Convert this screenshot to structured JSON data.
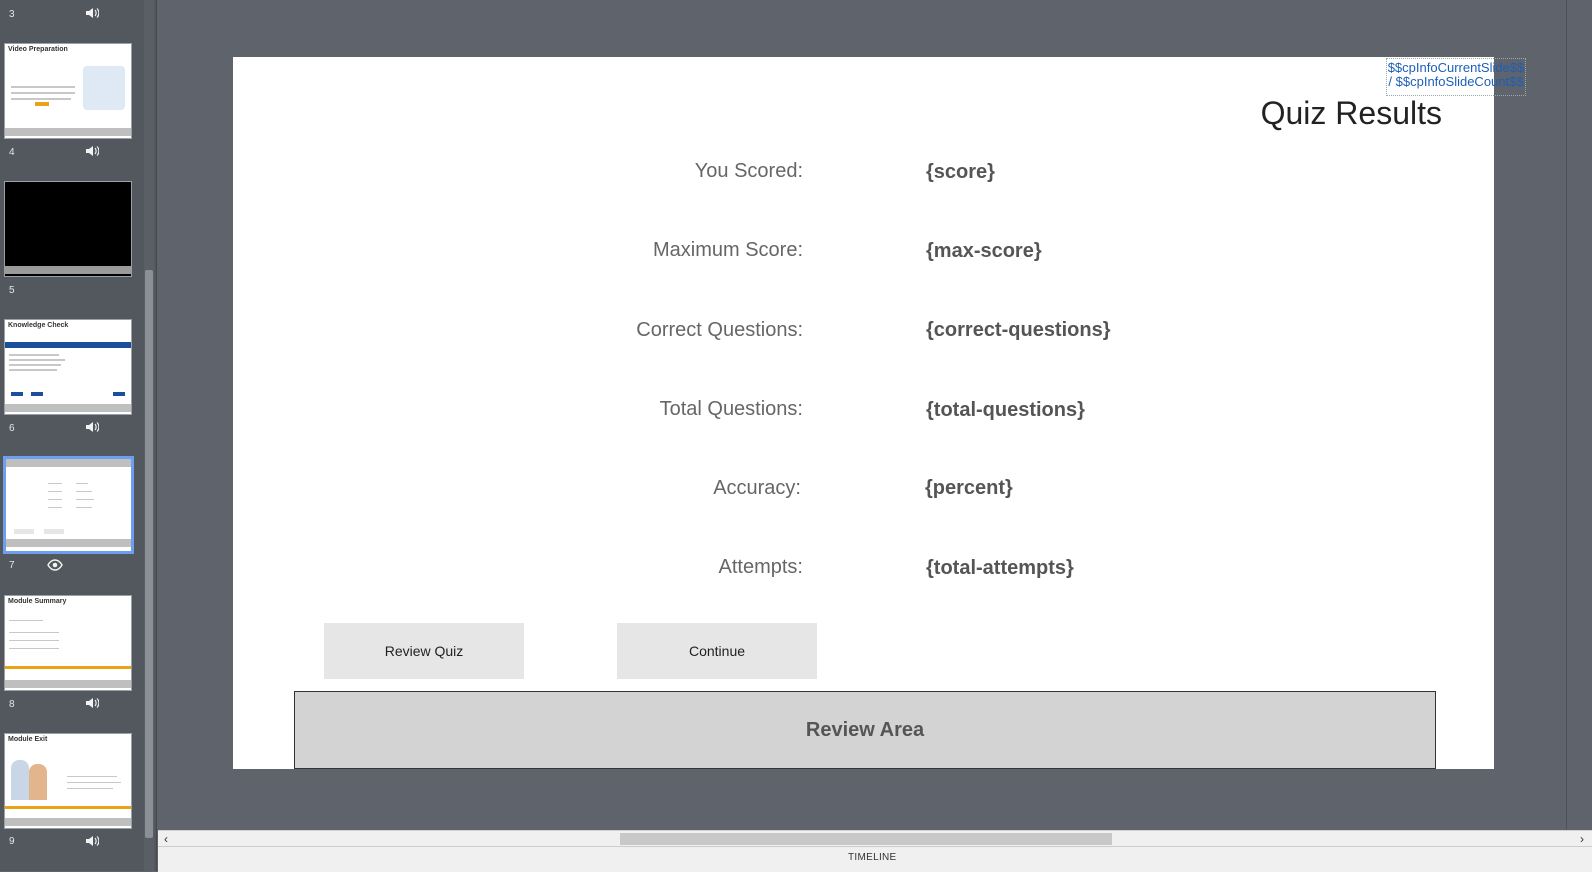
{
  "filmstrip": {
    "slides": [
      {
        "num": "3"
      },
      {
        "num": "4",
        "title": "Video Preparation"
      },
      {
        "num": "5"
      },
      {
        "num": "6",
        "title": "Knowledge Check"
      },
      {
        "num": "7"
      },
      {
        "num": "8",
        "title": "Module Summary"
      },
      {
        "num": "9",
        "title": "Module Exit"
      }
    ]
  },
  "slide": {
    "counter": "$$cpInfoCurrentSlide$$ / $$cpInfoSlideCount$$",
    "title": "Quiz Results",
    "rows": [
      {
        "label": "You Scored:",
        "value": "{score}"
      },
      {
        "label": "Maximum Score:",
        "value": "{max-score}"
      },
      {
        "label": "Correct Questions:",
        "value": "{correct-questions}"
      },
      {
        "label": "Total Questions:",
        "value": "{total-questions}"
      },
      {
        "label": "Accuracy:",
        "value": "{percent}"
      },
      {
        "label": "Attempts:",
        "value": "{total-attempts}"
      }
    ],
    "review_quiz_label": "Review Quiz",
    "continue_label": "Continue",
    "review_area_label": "Review Area"
  },
  "timeline": {
    "label": "TIMELINE"
  },
  "colors": {
    "selected_border": "#6d9fef",
    "counter_text": "#1d5fb8"
  },
  "icons": {
    "audio": "speaker-icon",
    "preview": "eye-icon"
  }
}
